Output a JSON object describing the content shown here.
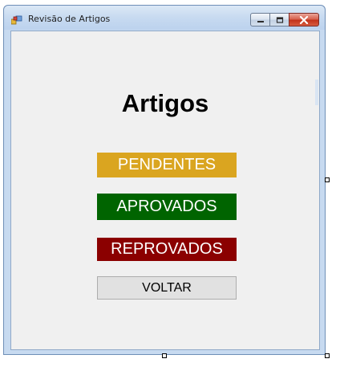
{
  "window": {
    "title": "Revisão de Artigos",
    "controls": {
      "minimize": "minimize-icon",
      "maximize": "maximize-icon",
      "close": "close-icon"
    }
  },
  "form": {
    "heading": "Artigos",
    "buttons": {
      "pendentes": "PENDENTES",
      "aprovados": "APROVADOS",
      "reprovados": "REPROVADOS",
      "voltar": "VOLTAR"
    }
  },
  "colors": {
    "pendentes": "#daa520",
    "aprovados": "#006400",
    "reprovados": "#8b0000",
    "voltar": "#e1e1e1",
    "client_background": "#f0f0f0",
    "close_button": "#c2331b"
  }
}
